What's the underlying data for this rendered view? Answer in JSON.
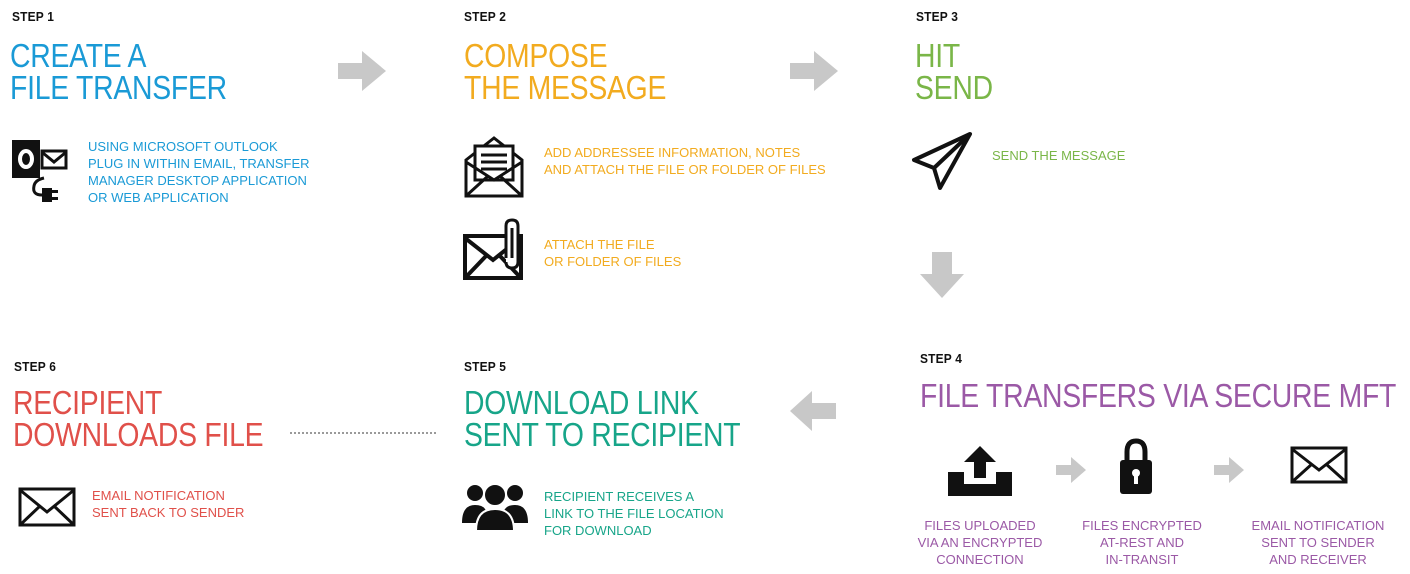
{
  "colors": {
    "step1": "#1a9ad6",
    "step2": "#f2ab1f",
    "step3": "#7ab648",
    "step4": "#9b59a6",
    "step5": "#17a589",
    "step6": "#e0504a",
    "arrow": "#c8c8c8"
  },
  "steps": {
    "s1": {
      "label": "STEP 1",
      "title_line1": "CREATE A",
      "title_line2": "FILE TRANSFER",
      "icon": "outlook-plugin-icon",
      "desc": "USING MICROSOFT OUTLOOK\nPLUG IN WITHIN EMAIL, TRANSFER\nMANAGER DESKTOP APPLICATION\nOR WEB APPLICATION"
    },
    "s2": {
      "label": "STEP 2",
      "title_line1": "COMPOSE",
      "title_line2": "THE MESSAGE",
      "items": [
        {
          "icon": "open-envelope-letter-icon",
          "text": "ADD ADDRESSEE INFORMATION, NOTES\nAND ATTACH THE FILE OR FOLDER OF FILES"
        },
        {
          "icon": "envelope-paperclip-icon",
          "text": "ATTACH THE FILE\nOR FOLDER OF FILES"
        }
      ]
    },
    "s3": {
      "label": "STEP 3",
      "title_line1": "HIT",
      "title_line2": "SEND",
      "icon": "paper-plane-icon",
      "desc": "SEND THE MESSAGE"
    },
    "s4": {
      "label": "STEP 4",
      "title": "FILE TRANSFERS VIA SECURE MFT",
      "items": [
        {
          "icon": "upload-tray-icon",
          "text": "FILES UPLOADED\nVIA AN ENCRYPTED\nCONNECTION"
        },
        {
          "icon": "padlock-icon",
          "text": "FILES ENCRYPTED\nAT-REST AND\nIN-TRANSIT"
        },
        {
          "icon": "envelope-icon",
          "text": "EMAIL NOTIFICATION\nSENT TO SENDER\nAND RECEIVER"
        }
      ]
    },
    "s5": {
      "label": "STEP 5",
      "title_line1": "DOWNLOAD LINK",
      "title_line2": "SENT TO RECIPIENT",
      "icon": "user-group-icon",
      "desc": "RECIPIENT RECEIVES A\nLINK TO THE FILE LOCATION\nFOR DOWNLOAD"
    },
    "s6": {
      "label": "STEP 6",
      "title_line1": "RECIPIENT",
      "title_line2": "DOWNLOADS FILE",
      "icon": "envelope-icon",
      "desc": "EMAIL NOTIFICATION\nSENT BACK TO SENDER"
    }
  }
}
